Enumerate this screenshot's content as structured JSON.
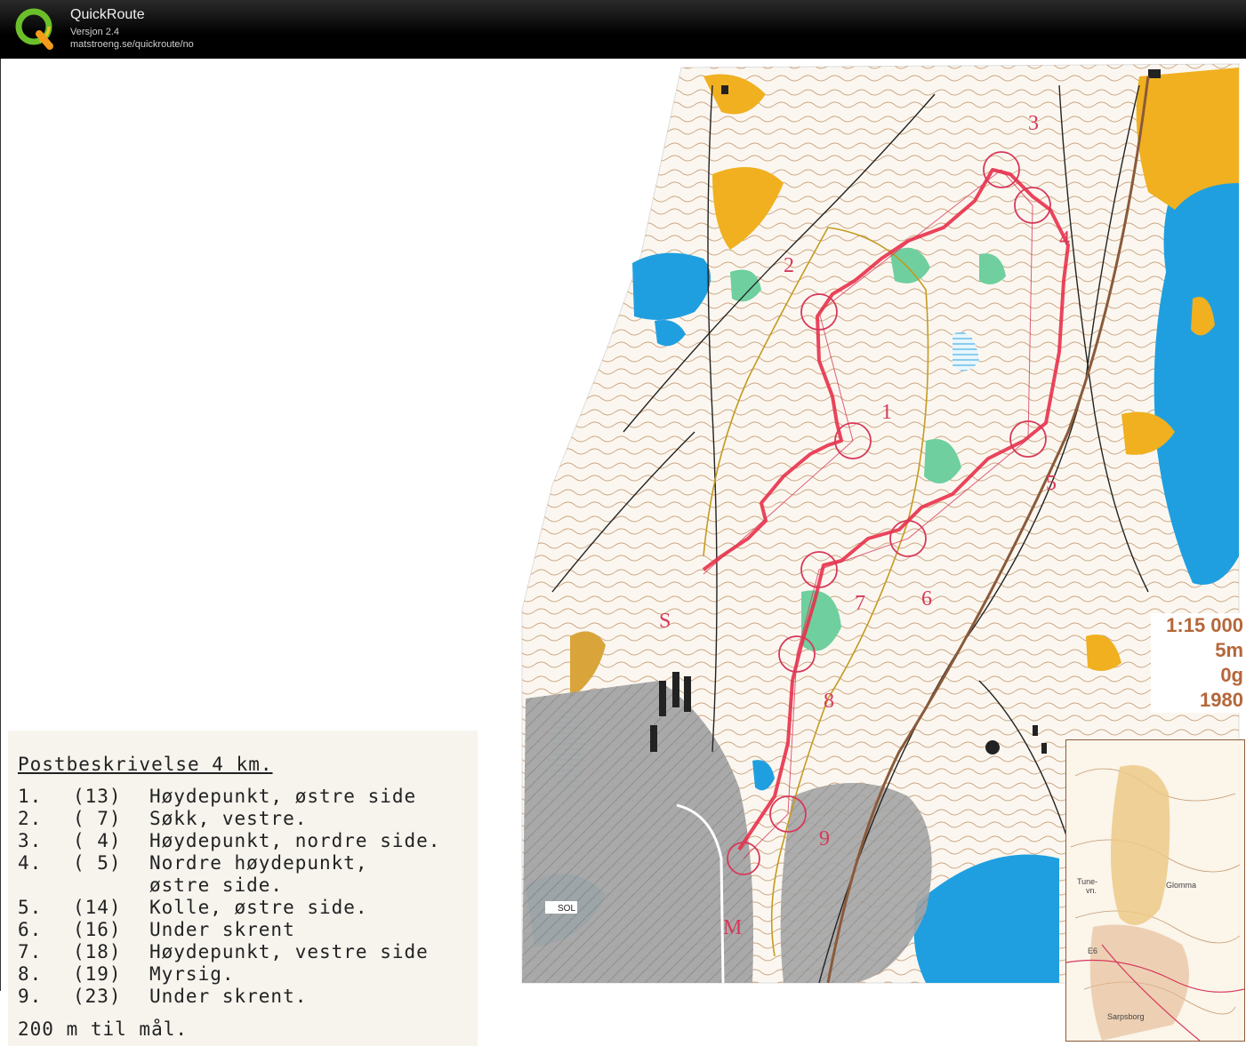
{
  "header": {
    "title": "QuickRoute",
    "version": "Versjon 2.4",
    "url": "matstroeng.se/quickroute/no"
  },
  "control_description": {
    "title": "Postbeskrivelse 4 km.",
    "rows": [
      {
        "num": "1.",
        "code": "(13)",
        "text": "Høydepunkt, østre side"
      },
      {
        "num": "2.",
        "code": "( 7)",
        "text": "Søkk, vestre."
      },
      {
        "num": "3.",
        "code": "( 4)",
        "text": "Høydepunkt, nordre side."
      },
      {
        "num": "4.",
        "code": "( 5)",
        "text": "Nordre høydepunkt,"
      },
      {
        "num": "",
        "code": "",
        "text": "østre side."
      },
      {
        "num": "5.",
        "code": "(14)",
        "text": "Kolle, østre side."
      },
      {
        "num": "6.",
        "code": "(16)",
        "text": "Under skrent"
      },
      {
        "num": "7.",
        "code": "(18)",
        "text": "Høydepunkt, vestre side"
      },
      {
        "num": "8.",
        "code": "(19)",
        "text": "Myrsig."
      },
      {
        "num": "9.",
        "code": "(23)",
        "text": "Under skrent."
      }
    ],
    "footer": "200 m til mål."
  },
  "map_info": {
    "scale": "1:15 000",
    "contour": "5m",
    "declination": "0g",
    "year": "1980"
  },
  "inset_labels": {
    "tune": "Tune-",
    "tune2": "vn.",
    "glomma": "Glomma",
    "e6": "E6",
    "sarpsborg": "Sarpsborg"
  },
  "map_labels": {
    "sol": "SOL"
  },
  "control_numbers": [
    "1",
    "2",
    "3",
    "4",
    "5",
    "6",
    "7",
    "8",
    "9",
    "S",
    "M"
  ],
  "colors": {
    "route": "#e8304a",
    "control": "#d8385a",
    "water": "#1f9fe0",
    "field": "#f0b020",
    "contour": "#c49a72",
    "restricted": "#9a9a9a"
  }
}
